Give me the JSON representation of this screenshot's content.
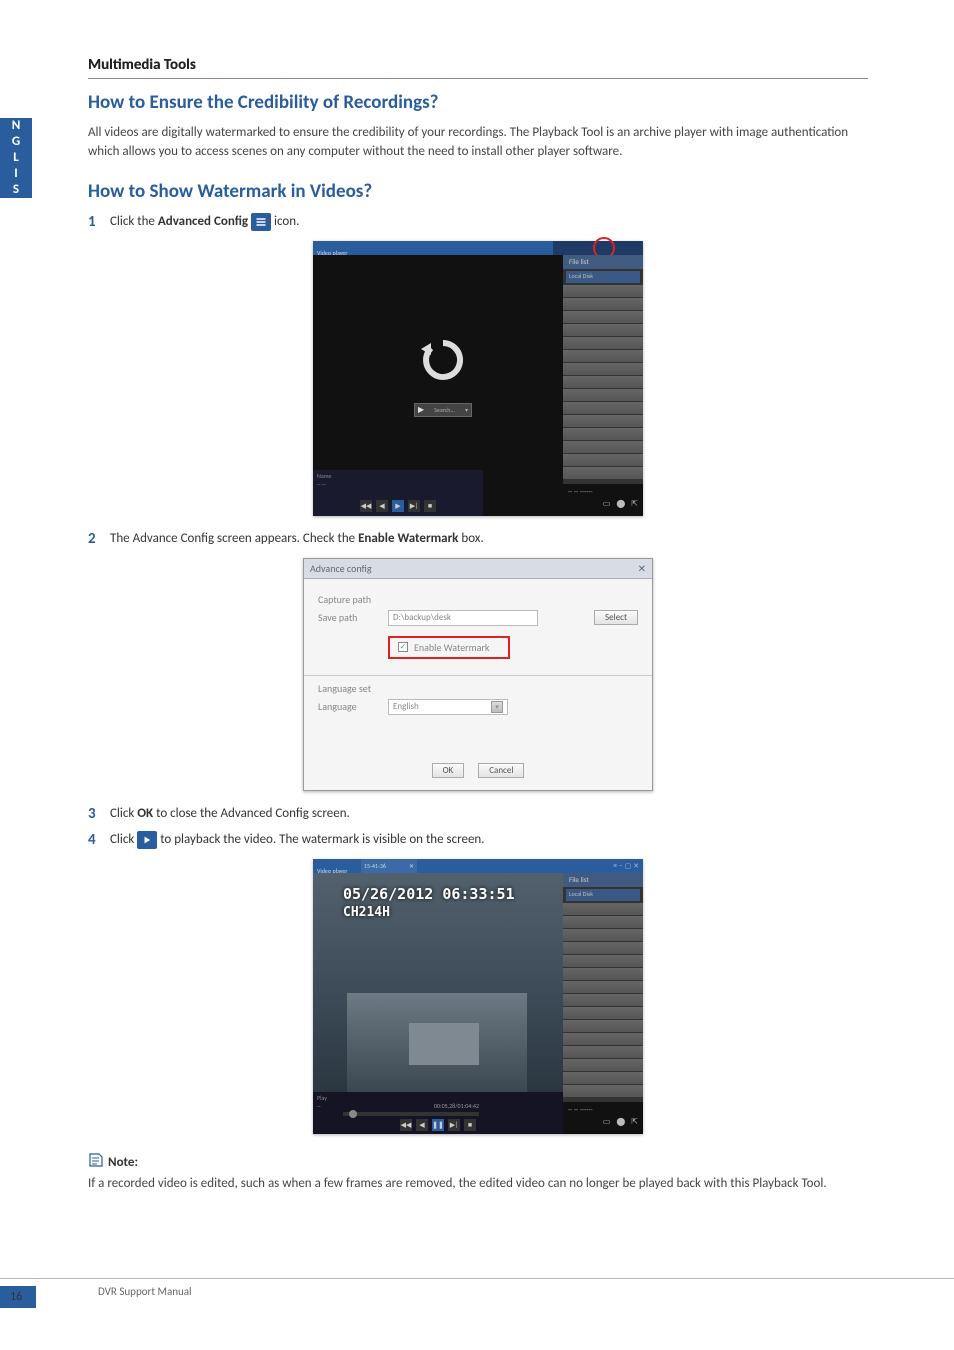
{
  "side_tab": "ENGLISH",
  "section_label": "Multimedia Tools",
  "h1": "How to Ensure the Credibility of Recordings?",
  "intro": "All videos are digitally watermarked to ensure the credibility of your recordings. The Playback Tool is an archive player with image authentication which allows you to access scenes on any computer without the need to install other player software.",
  "h2": "How to Show Watermark in Videos?",
  "steps": {
    "s1_pre": "Click the ",
    "s1_bold": "Advanced Config",
    "s1_post": " icon.",
    "s2_pre": "The Advance Config screen appears. Check the ",
    "s2_bold": "Enable Watermark",
    "s2_post": " box.",
    "s3_pre": "Click ",
    "s3_bold": "OK",
    "s3_post": " to close the Advanced Config screen.",
    "s4_pre": "Click ",
    "s4_post": " to playback the video. The watermark is visible on the screen."
  },
  "shot1": {
    "title_left": "Video player",
    "tab_label": "File list",
    "entry": "Local Disk",
    "chip_label": "Search...",
    "chip_arrow": "▾",
    "meta1": "Name",
    "meta2": "-- --",
    "rb_text": "-- -- ------",
    "controls": {
      "slow": "◀◀",
      "prev": "◀",
      "play": "▶",
      "next": "▶|",
      "stop": "■"
    },
    "rb_icons": {
      "a": "▭",
      "b": "⬤",
      "c": "⇱"
    }
  },
  "shot2": {
    "title": "Advance config",
    "close": "✕",
    "capture_label": "Capture path",
    "save_label": "Save path",
    "path_value": "D:\\backup\\desk",
    "select_btn": "Select",
    "check_label": "Enable Watermark",
    "check_mark": "✓",
    "lang_set": "Language set",
    "lang_label": "Language",
    "lang_value": "English",
    "sarr": "▾",
    "ok": "OK",
    "cancel": "Cancel"
  },
  "shot3": {
    "tab_text": "15-41-36",
    "tab_x": "✕",
    "tr_icons": {
      "a": "≡",
      "b": "–",
      "c": "▢",
      "d": "✕"
    },
    "timestamp": "05/26/2012 06:33:51",
    "camera": "CH214H",
    "tab_label": "File list",
    "entry": "Local Disk",
    "meta1": "Play",
    "meta2": "--",
    "time_text": "00:05,28/01:04:42",
    "rb_text": "-- -- ------",
    "controls": {
      "slow": "◀◀",
      "prev": "◀",
      "pause": "❚❚",
      "next": "▶|",
      "stop": "■"
    },
    "rb_icons": {
      "a": "▭",
      "b": "⬤",
      "c": "⇱"
    }
  },
  "note": {
    "label": "Note:",
    "text": "If a recorded video is edited, such as when a few frames are removed, the edited video can no longer be played back with this Playback Tool."
  },
  "footer": {
    "manual": "DVR Support Manual",
    "page": "16"
  }
}
